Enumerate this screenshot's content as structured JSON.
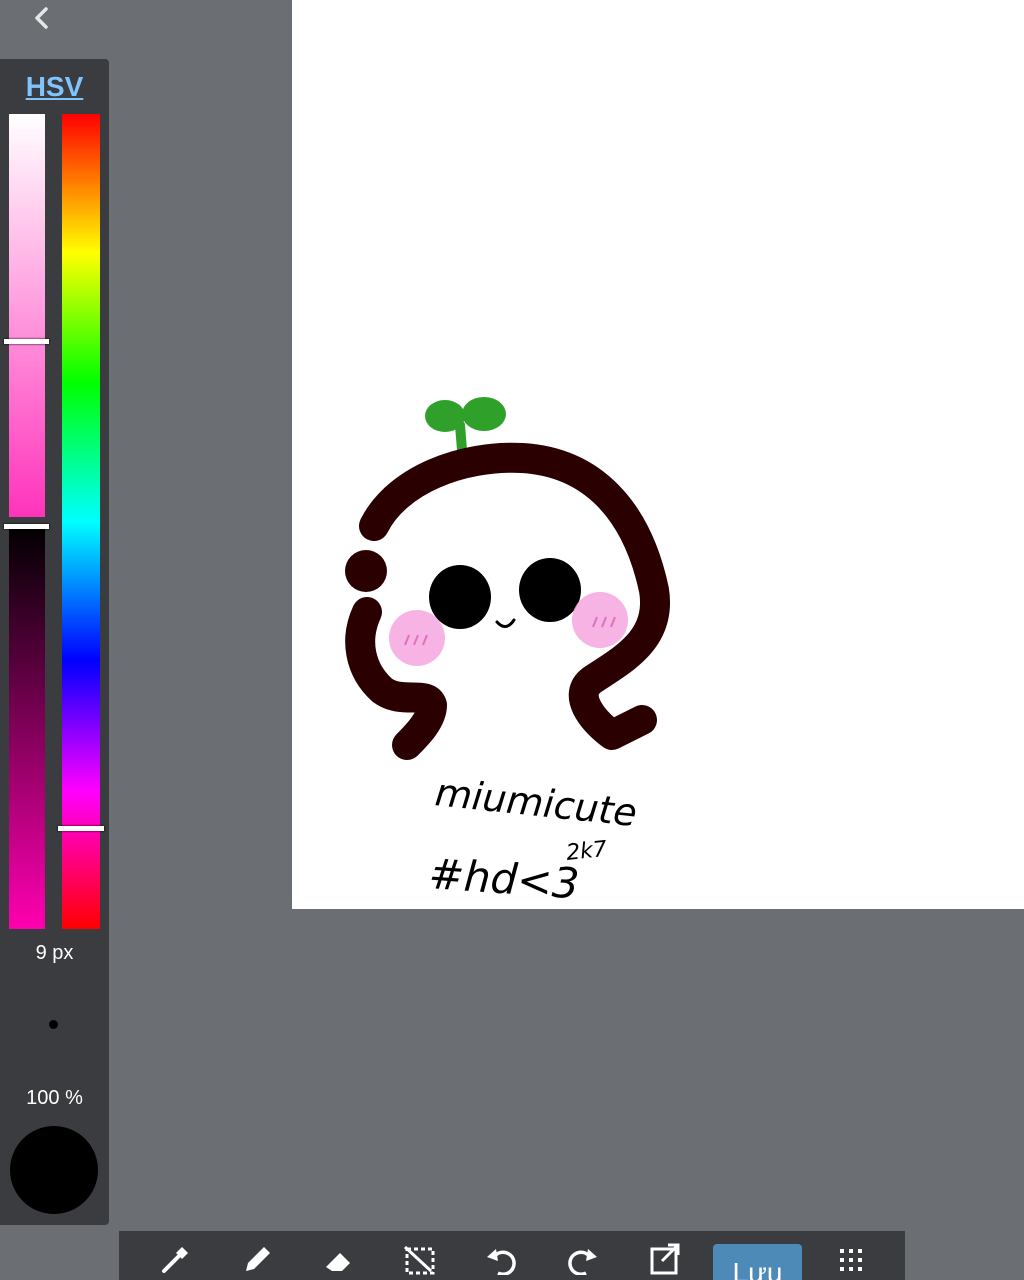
{
  "panel": {
    "mode_label": "HSV",
    "brush_size": "9 px",
    "opacity": "100 %"
  },
  "colors": {
    "current": "#000000",
    "accent": "#4e8ab8",
    "hsv_link": "#7fc4ff"
  },
  "canvas": {
    "handwriting_line1": "miumicute",
    "handwriting_line2": "2k7",
    "handwriting_line3": "#hd<3"
  },
  "toolbar": {
    "items": [
      "eyedropper-icon",
      "pen-icon",
      "eraser-icon",
      "select-icon",
      "undo-icon",
      "redo-icon",
      "transform-icon",
      "layers",
      "more-icon"
    ],
    "layers_label": "Lưu"
  }
}
